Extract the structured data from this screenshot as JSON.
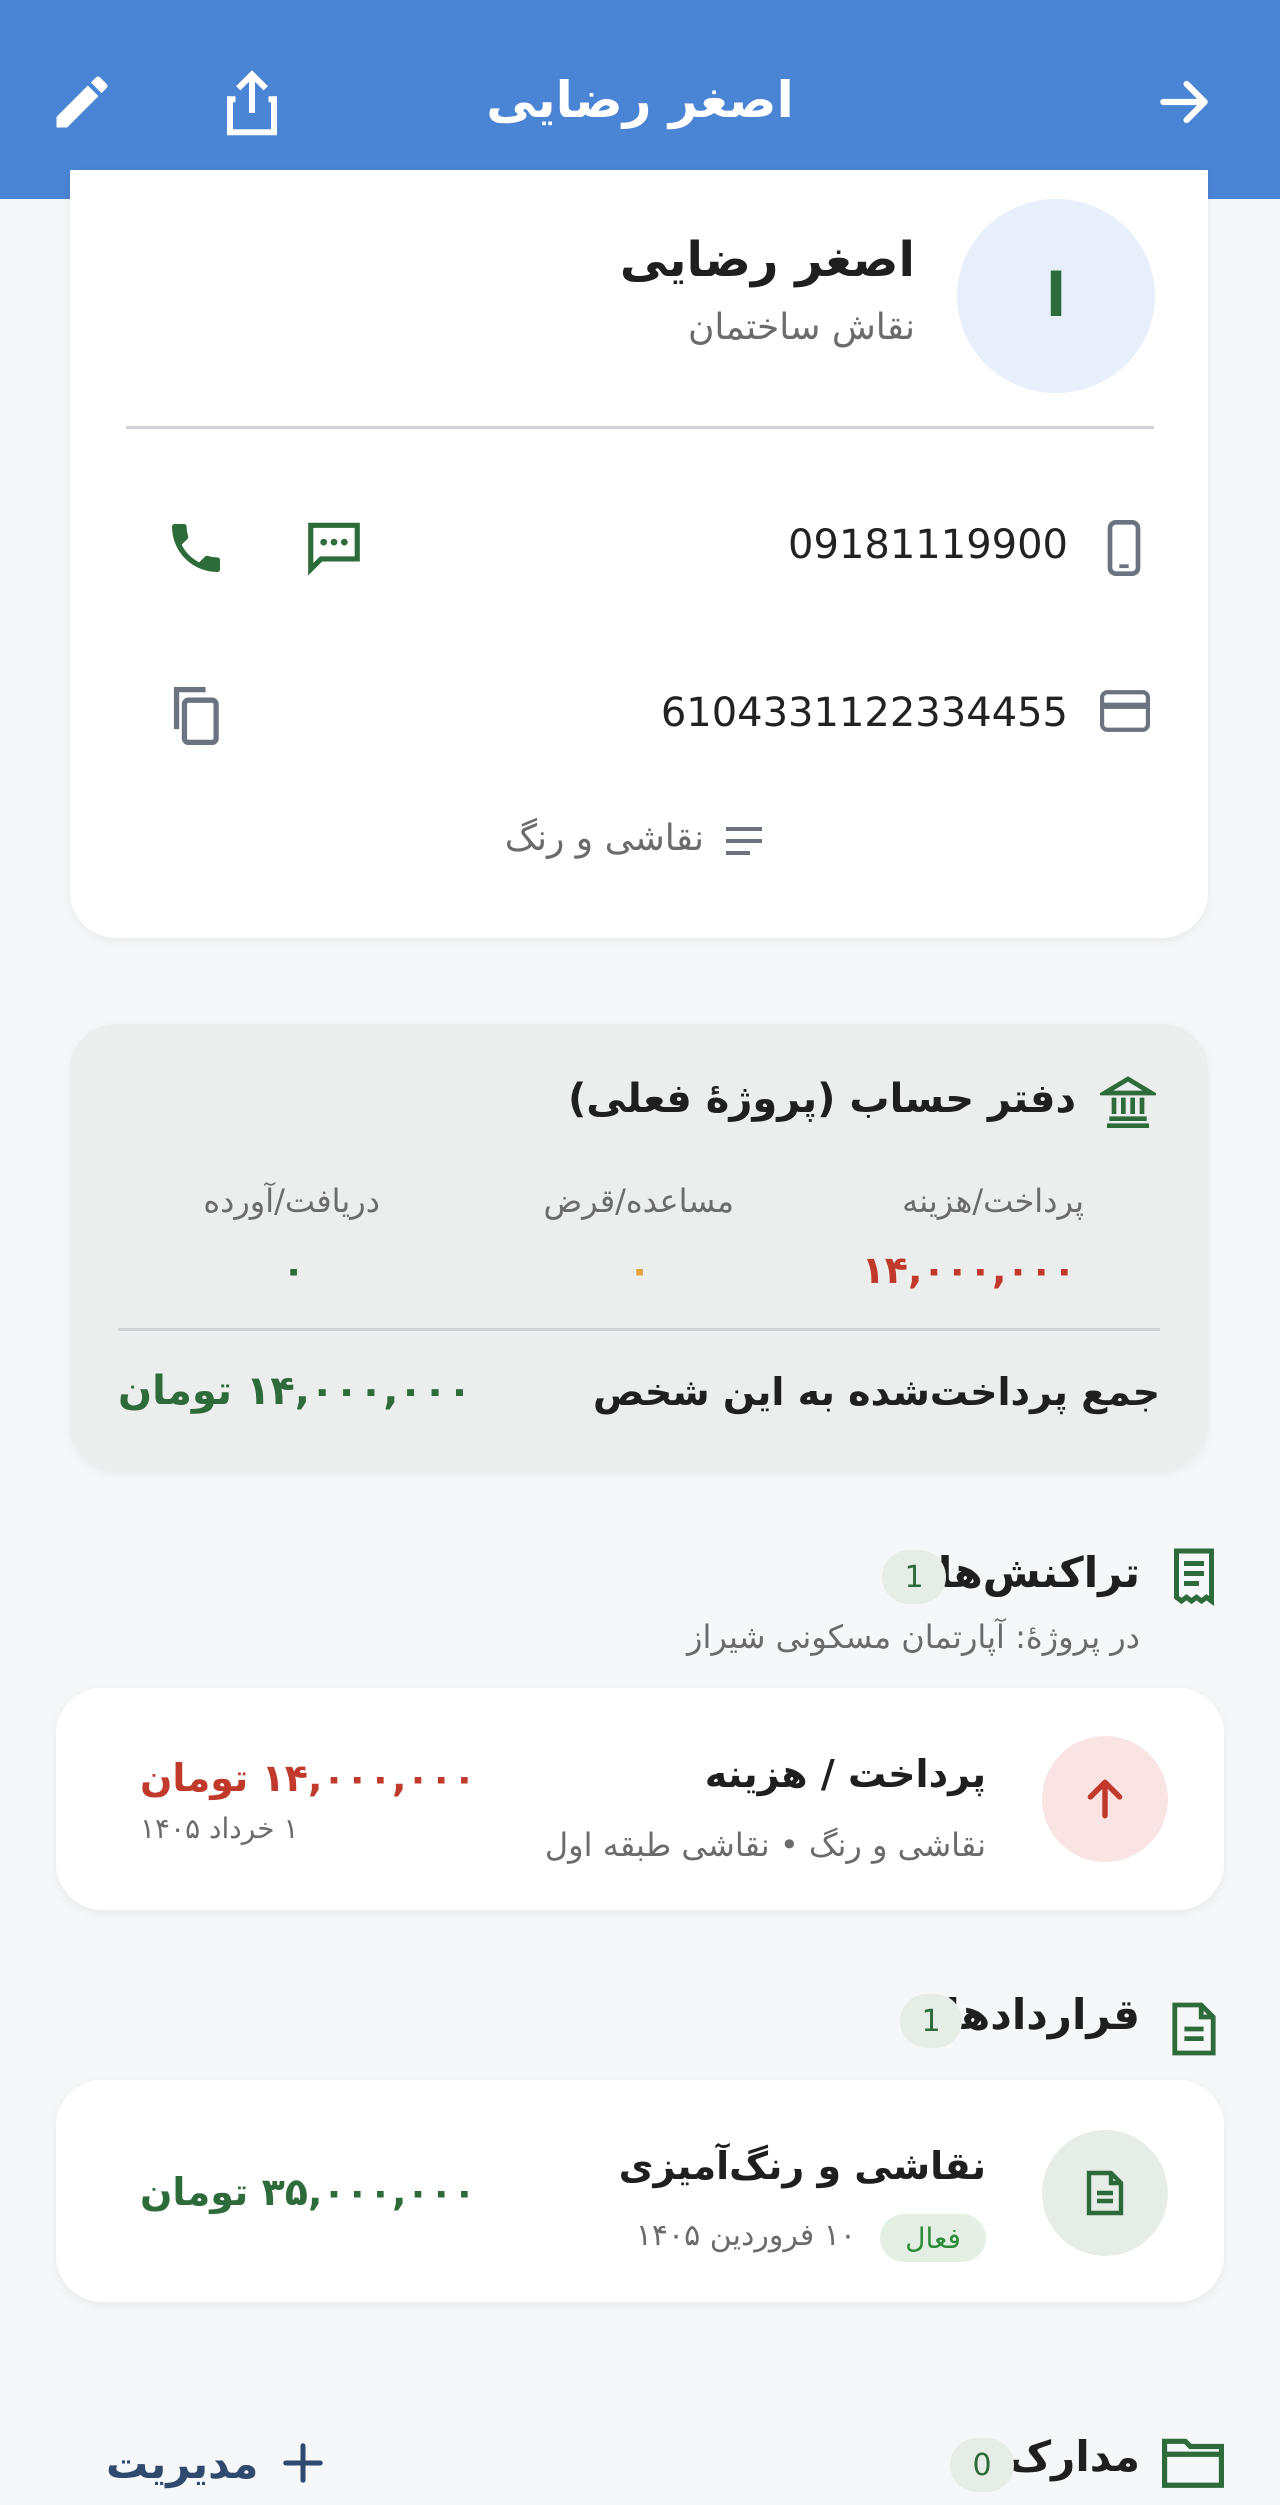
{
  "appbar": {
    "title": "اصغر رضایی",
    "icons": [
      "edit-icon",
      "share-icon",
      "arrow-forward-icon"
    ]
  },
  "profile": {
    "avatar_letter": "ا",
    "name": "اصغر رضایی",
    "role": "نقاش ساختمان",
    "phone": "09181119900",
    "card_number": "6104331122334455",
    "category": "نقاشی و رنگ"
  },
  "ledger": {
    "title": "دفتر حساب (پروژهٔ فعلی)",
    "columns": [
      {
        "label": "پرداخت/هزینه",
        "value": "۱۴,۰۰۰,۰۰۰"
      },
      {
        "label": "مساعده/قرض",
        "value": "۰"
      },
      {
        "label": "دریافت/آورده",
        "value": "۰"
      }
    ],
    "total_label": "جمع پرداخت‌شده به این شخص",
    "total_value": "۱۴,۰۰۰,۰۰۰ تومان"
  },
  "transactions": {
    "title": "تراکنش‌ها",
    "count": "1",
    "subtitle": "در پروژهٔ: آپارتمان مسکونی شیراز",
    "items": [
      {
        "title": "پرداخت / هزینه",
        "detail": "نقاشی و رنگ • نقاشی طبقه اول",
        "amount": "۱۴,۰۰۰,۰۰۰ تومان",
        "date": "۱ خرداد ۱۴۰۵"
      }
    ]
  },
  "contracts": {
    "title": "قراردادها",
    "count": "1",
    "items": [
      {
        "title": "نقاشی و رنگ‌آمیزی",
        "status": "فعال",
        "date": "۱۰ فروردین ۱۴۰۵",
        "amount": "۳۵,۰۰۰,۰۰۰ تومان"
      }
    ]
  },
  "documents": {
    "title": "مدارک",
    "count": "0",
    "manage_label": "مدیریت"
  },
  "colors": {
    "primary": "#4a84d4",
    "green": "#2e6b3a",
    "red": "#c0392b",
    "orange": "#e6a23c"
  }
}
